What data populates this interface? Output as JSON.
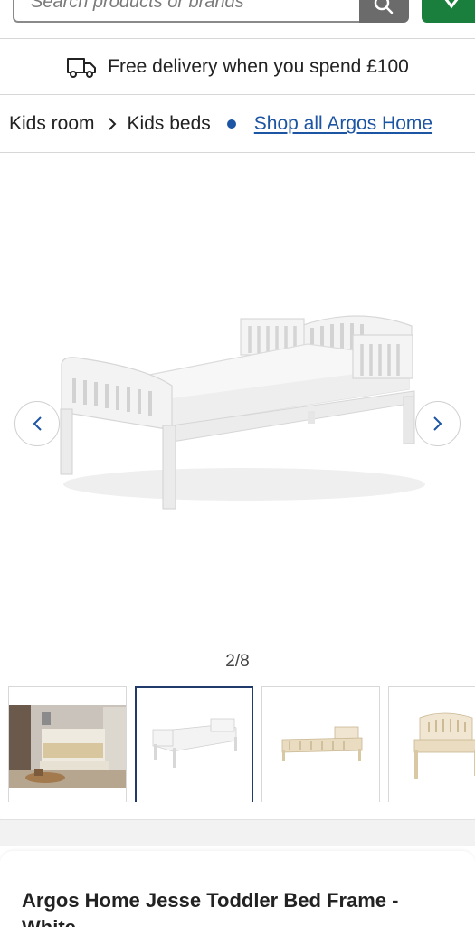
{
  "header": {
    "search_placeholder": "Search products or brands"
  },
  "delivery": {
    "text": "Free delivery when you spend £100"
  },
  "breadcrumb": {
    "items": [
      "Kids room",
      "Kids beds"
    ],
    "shop_all_link": "Shop all Argos Home"
  },
  "gallery": {
    "counter": "2/8",
    "current": 2,
    "total": 8,
    "thumbnails": [
      "room-scene",
      "white-bed",
      "pine-bed",
      "pine-bed-headboard"
    ]
  },
  "product": {
    "title": "Argos Home Jesse Toddler Bed Frame - White"
  },
  "colors": {
    "accent_blue": "#1c55a3",
    "brand_green": "#1a7e3d",
    "active_thumb_border": "#1f3a6b"
  }
}
